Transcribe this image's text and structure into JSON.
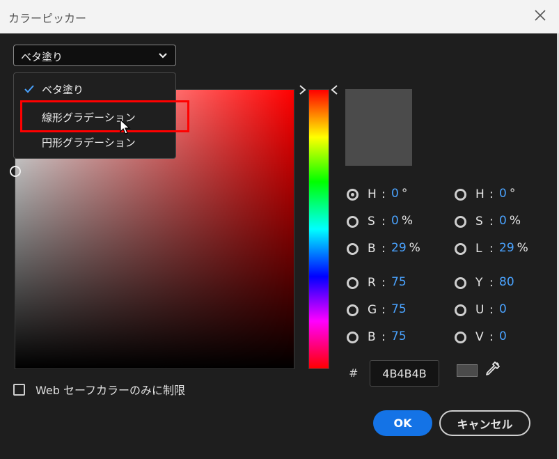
{
  "window": {
    "title": "カラーピッカー"
  },
  "fill_mode": {
    "selected": "ベタ塗り",
    "options": [
      "ベタ塗り",
      "線形グラデーション",
      "円形グラデーション"
    ]
  },
  "color": {
    "hsb": {
      "h_label": "H",
      "h": "0",
      "h_unit": "°",
      "s_label": "S",
      "s": "0",
      "s_unit": "%",
      "b_label": "B",
      "b": "29",
      "b_unit": "%"
    },
    "hsl": {
      "h_label": "H",
      "h": "0",
      "h_unit": "°",
      "s_label": "S",
      "s": "0",
      "s_unit": "%",
      "l_label": "L",
      "l": "29",
      "l_unit": "%"
    },
    "rgb": {
      "r_label": "R",
      "r": "75",
      "g_label": "G",
      "g": "75",
      "b_label": "B",
      "b": "75"
    },
    "yuv": {
      "y_label": "Y",
      "y": "80",
      "u_label": "U",
      "u": "0",
      "v_label": "V",
      "v": "0"
    },
    "hash": "#",
    "hex": "4B4B4B",
    "swatch_color": "#4b4b4b"
  },
  "websafe": {
    "label": "Web セーフカラーのみに制限",
    "checked": false
  },
  "buttons": {
    "ok": "OK",
    "cancel": "キャンセル"
  },
  "colors": {
    "accent": "#1473e6",
    "value_text": "#4aa3ff",
    "highlight": "#ff0000"
  },
  "icons": [
    "close-icon",
    "chevron-down-icon",
    "checkmark-icon",
    "mouse-cursor-icon",
    "eyedropper-icon"
  ]
}
